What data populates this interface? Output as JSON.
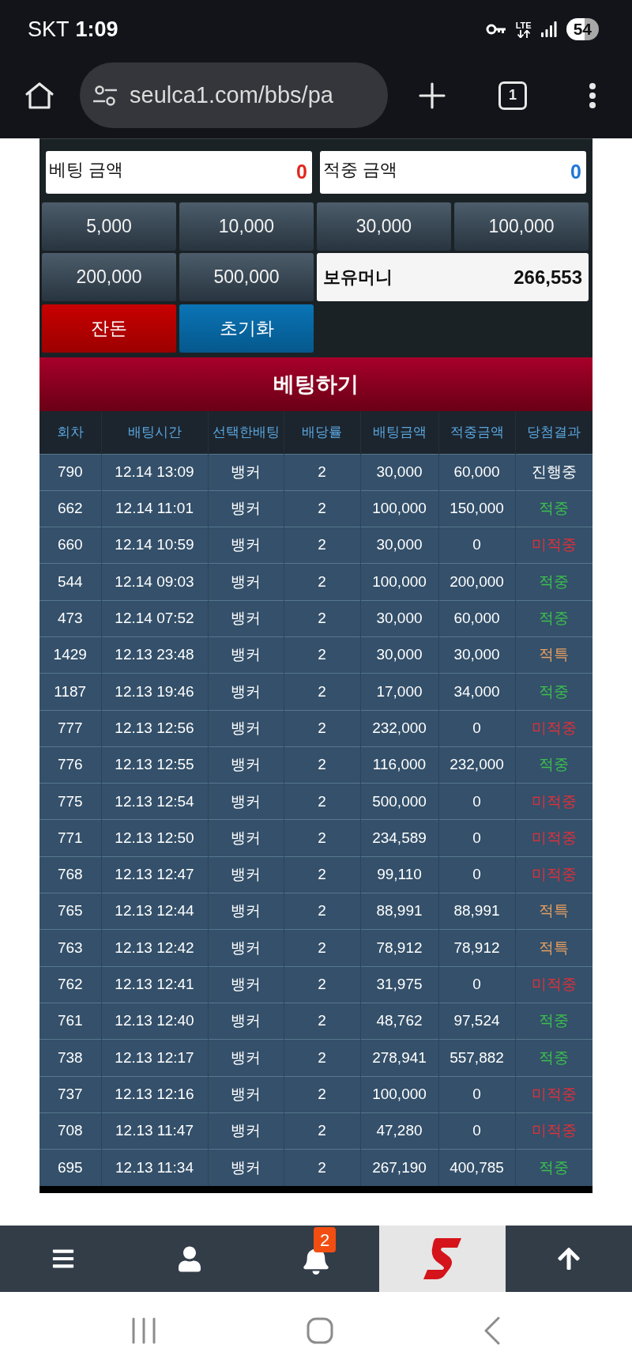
{
  "status_bar": {
    "carrier": "SKT",
    "time": "1:09",
    "network": "LTE",
    "battery": "54"
  },
  "browser": {
    "url": "seulca1.com/bbs/pa",
    "tab_count": "1"
  },
  "bet_form": {
    "fields": [
      {
        "label": "베팅 금액",
        "value": "0",
        "color": "#e0281e"
      },
      {
        "label": "적중 금액",
        "value": "0",
        "color": "#1e78d8"
      }
    ],
    "amount_buttons": [
      "5,000",
      "10,000",
      "30,000",
      "100,000",
      "200,000",
      "500,000"
    ],
    "balance": {
      "label": "보유머니",
      "value": "266,553"
    },
    "action_buttons": [
      {
        "label": "잔돈",
        "kind": "change"
      },
      {
        "label": "초기화",
        "kind": "reset"
      }
    ],
    "submit": "베팅하기"
  },
  "table": {
    "columns": [
      "회차",
      "배팅시간",
      "선택한배팅",
      "배당률",
      "배팅금액",
      "적중금액",
      "당첨결과"
    ],
    "rows": [
      {
        "round": "790",
        "time": "12.14 13:09",
        "pick": "뱅커",
        "odds": "2",
        "bet": "30,000",
        "payout": "60,000",
        "result": "진행중",
        "color": "#ffffff"
      },
      {
        "round": "662",
        "time": "12.14 11:01",
        "pick": "뱅커",
        "odds": "2",
        "bet": "100,000",
        "payout": "150,000",
        "result": "적중",
        "color": "#3cc04e"
      },
      {
        "round": "660",
        "time": "12.14 10:59",
        "pick": "뱅커",
        "odds": "2",
        "bet": "30,000",
        "payout": "0",
        "result": "미적중",
        "color": "#e0303a"
      },
      {
        "round": "544",
        "time": "12.14 09:03",
        "pick": "뱅커",
        "odds": "2",
        "bet": "100,000",
        "payout": "200,000",
        "result": "적중",
        "color": "#3cc04e"
      },
      {
        "round": "473",
        "time": "12.14 07:52",
        "pick": "뱅커",
        "odds": "2",
        "bet": "30,000",
        "payout": "60,000",
        "result": "적중",
        "color": "#3cc04e"
      },
      {
        "round": "1429",
        "time": "12.13 23:48",
        "pick": "뱅커",
        "odds": "2",
        "bet": "30,000",
        "payout": "30,000",
        "result": "적특",
        "color": "#e8a060"
      },
      {
        "round": "1187",
        "time": "12.13 19:46",
        "pick": "뱅커",
        "odds": "2",
        "bet": "17,000",
        "payout": "34,000",
        "result": "적중",
        "color": "#3cc04e"
      },
      {
        "round": "777",
        "time": "12.13 12:56",
        "pick": "뱅커",
        "odds": "2",
        "bet": "232,000",
        "payout": "0",
        "result": "미적중",
        "color": "#e0303a"
      },
      {
        "round": "776",
        "time": "12.13 12:55",
        "pick": "뱅커",
        "odds": "2",
        "bet": "116,000",
        "payout": "232,000",
        "result": "적중",
        "color": "#3cc04e"
      },
      {
        "round": "775",
        "time": "12.13 12:54",
        "pick": "뱅커",
        "odds": "2",
        "bet": "500,000",
        "payout": "0",
        "result": "미적중",
        "color": "#e0303a"
      },
      {
        "round": "771",
        "time": "12.13 12:50",
        "pick": "뱅커",
        "odds": "2",
        "bet": "234,589",
        "payout": "0",
        "result": "미적중",
        "color": "#e0303a"
      },
      {
        "round": "768",
        "time": "12.13 12:47",
        "pick": "뱅커",
        "odds": "2",
        "bet": "99,110",
        "payout": "0",
        "result": "미적중",
        "color": "#e0303a"
      },
      {
        "round": "765",
        "time": "12.13 12:44",
        "pick": "뱅커",
        "odds": "2",
        "bet": "88,991",
        "payout": "88,991",
        "result": "적특",
        "color": "#e8a060"
      },
      {
        "round": "763",
        "time": "12.13 12:42",
        "pick": "뱅커",
        "odds": "2",
        "bet": "78,912",
        "payout": "78,912",
        "result": "적특",
        "color": "#e8a060"
      },
      {
        "round": "762",
        "time": "12.13 12:41",
        "pick": "뱅커",
        "odds": "2",
        "bet": "31,975",
        "payout": "0",
        "result": "미적중",
        "color": "#e0303a"
      },
      {
        "round": "761",
        "time": "12.13 12:40",
        "pick": "뱅커",
        "odds": "2",
        "bet": "48,762",
        "payout": "97,524",
        "result": "적중",
        "color": "#3cc04e"
      },
      {
        "round": "738",
        "time": "12.13 12:17",
        "pick": "뱅커",
        "odds": "2",
        "bet": "278,941",
        "payout": "557,882",
        "result": "적중",
        "color": "#3cc04e"
      },
      {
        "round": "737",
        "time": "12.13 12:16",
        "pick": "뱅커",
        "odds": "2",
        "bet": "100,000",
        "payout": "0",
        "result": "미적중",
        "color": "#e0303a"
      },
      {
        "round": "708",
        "time": "12.13 11:47",
        "pick": "뱅커",
        "odds": "2",
        "bet": "47,280",
        "payout": "0",
        "result": "미적중",
        "color": "#e0303a"
      },
      {
        "round": "695",
        "time": "12.13 11:34",
        "pick": "뱅커",
        "odds": "2",
        "bet": "267,190",
        "payout": "400,785",
        "result": "적중",
        "color": "#3cc04e"
      }
    ]
  },
  "bottom_nav": {
    "badge": "2"
  }
}
